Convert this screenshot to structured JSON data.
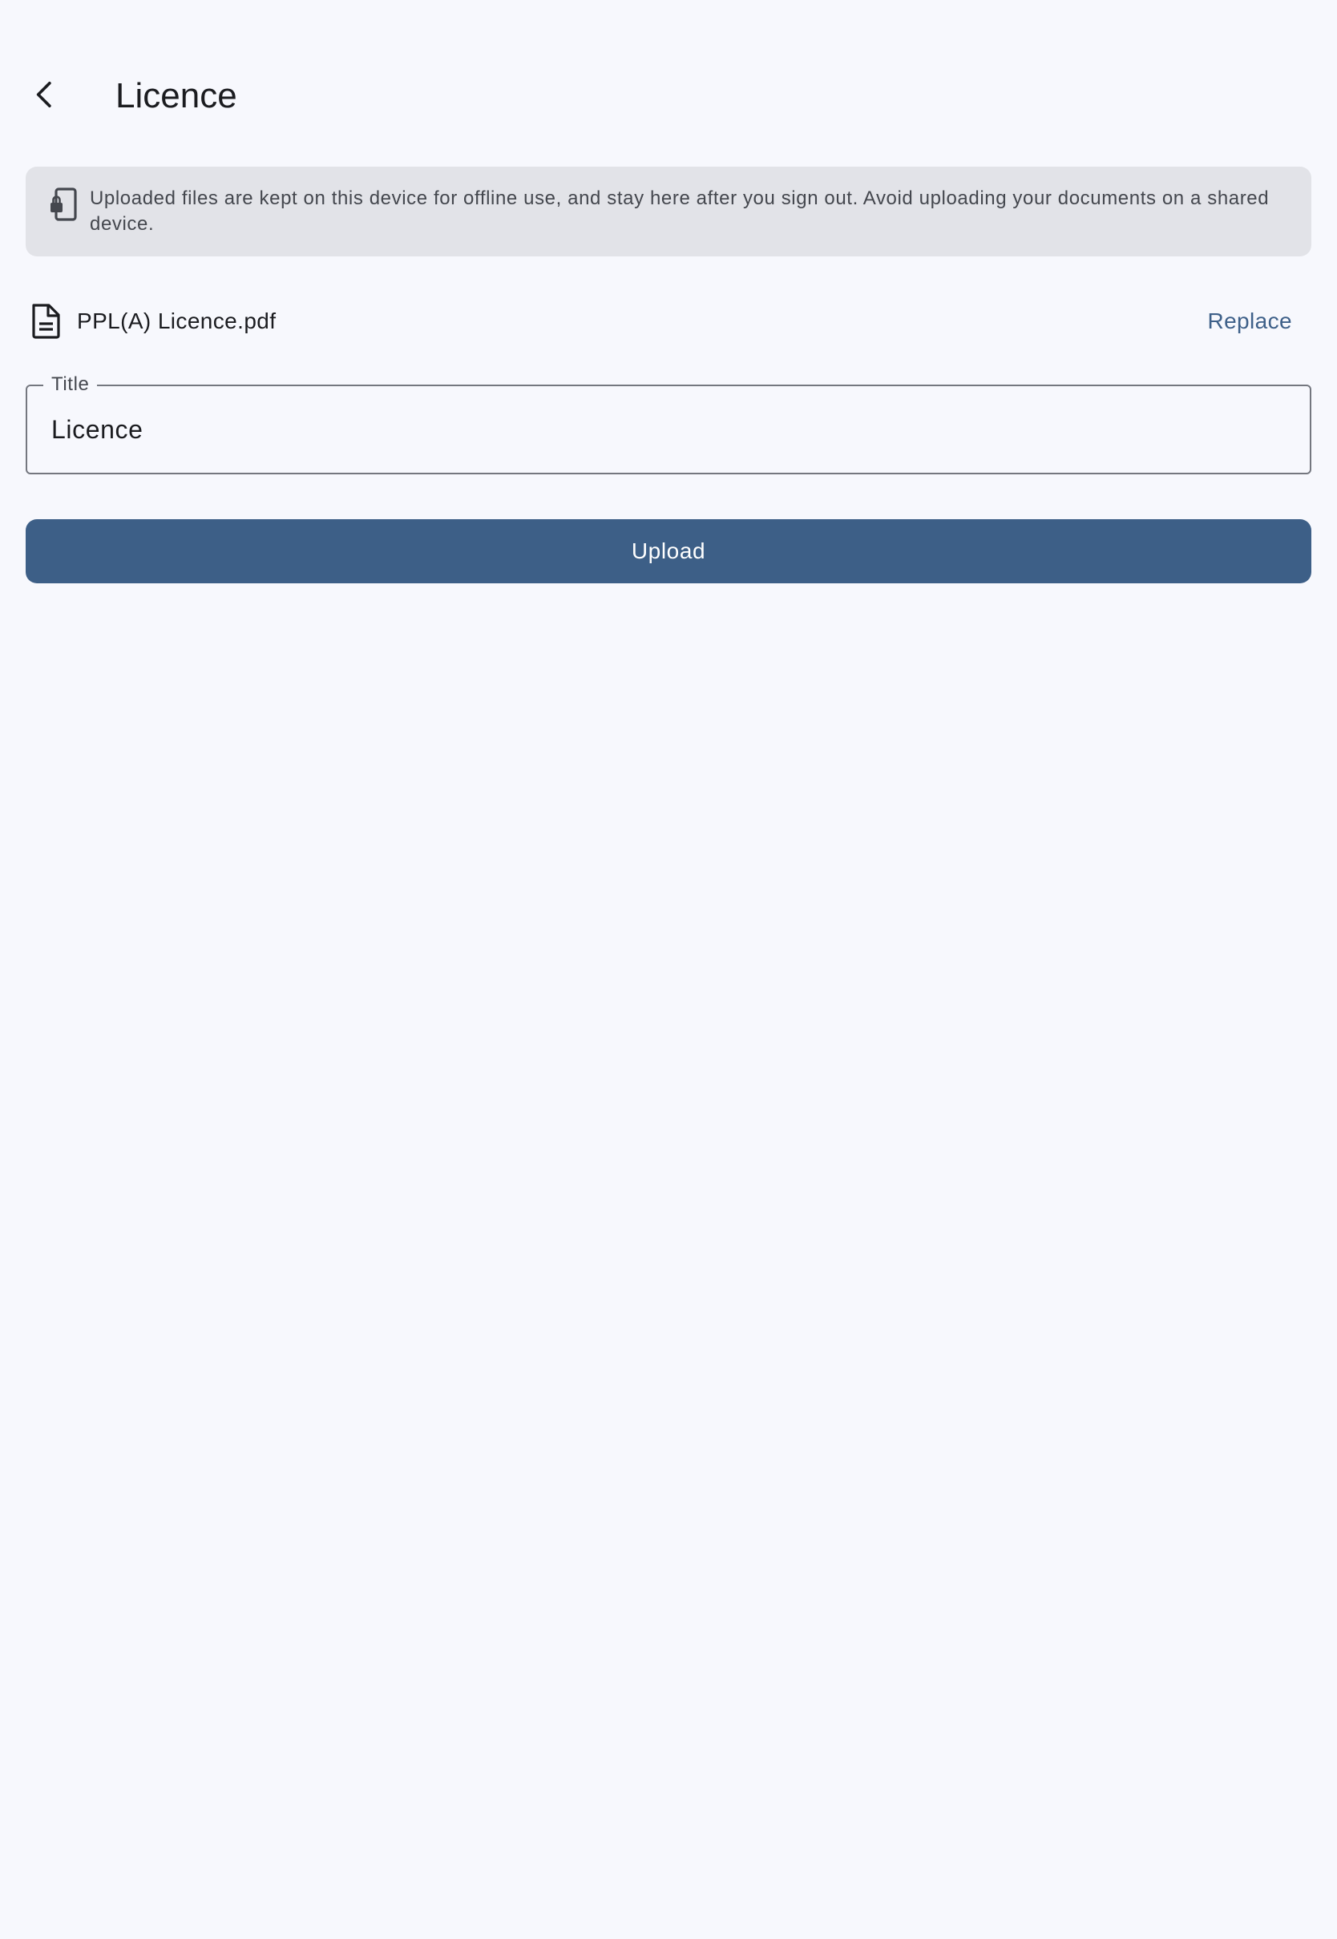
{
  "header": {
    "title": "Licence",
    "back_icon": "chevron-left-icon"
  },
  "notice": {
    "icon": "lock-device-icon",
    "text": "Uploaded files are kept on this device for offline use, and stay here after you sign out. Avoid uploading your documents on a shared device."
  },
  "file": {
    "icon": "file-document-icon",
    "name": "PPL(A) Licence.pdf",
    "replace_label": "Replace"
  },
  "title_field": {
    "label": "Title",
    "value": "Licence"
  },
  "upload": {
    "label": "Upload"
  },
  "colors": {
    "background": "#f7f8fd",
    "primary": "#3d5f87",
    "notice_background": "#e2e3e8",
    "link": "#3e6089"
  }
}
